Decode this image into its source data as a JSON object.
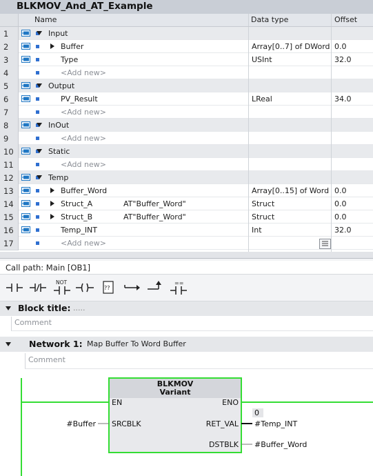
{
  "window": {
    "title": "BLKMOV_And_AT_Example"
  },
  "table": {
    "headers": {
      "name": "Name",
      "datatype": "Data type",
      "offset": "Offset"
    },
    "rows": [
      {
        "num": "1",
        "kind": "group",
        "expand": "down",
        "name": "Input",
        "at": "",
        "datatype": "",
        "offset": ""
      },
      {
        "num": "2",
        "kind": "item",
        "expand": "right",
        "name": "Buffer",
        "at": "",
        "datatype": "Array[0..7] of DWord",
        "offset": "0.0"
      },
      {
        "num": "3",
        "kind": "item",
        "expand": "",
        "name": "Type",
        "at": "",
        "datatype": "USInt",
        "offset": "32.0"
      },
      {
        "num": "4",
        "kind": "add",
        "expand": "",
        "name": "<Add new>",
        "at": "",
        "datatype": "",
        "offset": ""
      },
      {
        "num": "5",
        "kind": "group",
        "expand": "down",
        "name": "Output",
        "at": "",
        "datatype": "",
        "offset": ""
      },
      {
        "num": "6",
        "kind": "item",
        "expand": "",
        "name": "PV_Result",
        "at": "",
        "datatype": "LReal",
        "offset": "34.0"
      },
      {
        "num": "7",
        "kind": "add",
        "expand": "",
        "name": "<Add new>",
        "at": "",
        "datatype": "",
        "offset": ""
      },
      {
        "num": "8",
        "kind": "group",
        "expand": "down",
        "name": "InOut",
        "at": "",
        "datatype": "",
        "offset": ""
      },
      {
        "num": "9",
        "kind": "add",
        "expand": "",
        "name": "<Add new>",
        "at": "",
        "datatype": "",
        "offset": ""
      },
      {
        "num": "10",
        "kind": "group",
        "expand": "down",
        "name": "Static",
        "at": "",
        "datatype": "",
        "offset": ""
      },
      {
        "num": "11",
        "kind": "add",
        "expand": "",
        "name": "<Add new>",
        "at": "",
        "datatype": "",
        "offset": ""
      },
      {
        "num": "12",
        "kind": "group",
        "expand": "down",
        "name": "Temp",
        "at": "",
        "datatype": "",
        "offset": ""
      },
      {
        "num": "13",
        "kind": "item",
        "expand": "right",
        "name": "Buffer_Word",
        "at": "",
        "datatype": "Array[0..15] of Word",
        "offset": "0.0"
      },
      {
        "num": "14",
        "kind": "item",
        "expand": "right",
        "name": "Struct_A",
        "at": "AT\"Buffer_Word\"",
        "datatype": "Struct",
        "offset": "0.0"
      },
      {
        "num": "15",
        "kind": "item",
        "expand": "right",
        "name": "Struct_B",
        "at": "AT\"Buffer_Word\"",
        "datatype": "Struct",
        "offset": "0.0"
      },
      {
        "num": "16",
        "kind": "item",
        "expand": "",
        "name": "Temp_INT",
        "at": "",
        "datatype": "Int",
        "offset": "32.0"
      },
      {
        "num": "17",
        "kind": "add",
        "expand": "",
        "name": "<Add new>",
        "at": "",
        "datatype": "",
        "offset": ""
      }
    ]
  },
  "call_path": "Call path: Main [OB1]",
  "toolbar": {
    "buttons": [
      {
        "name": "contact-no-icon"
      },
      {
        "name": "contact-nc-icon"
      },
      {
        "name": "not-contact-icon",
        "label": "NOT"
      },
      {
        "name": "coil-icon"
      },
      {
        "name": "empty-box-icon",
        "label": "??"
      },
      {
        "name": "open-branch-icon"
      },
      {
        "name": "close-branch-icon"
      },
      {
        "name": "compare-contact-icon",
        "label": "=="
      }
    ]
  },
  "block": {
    "title_label": "Block title:",
    "title_value": ".....",
    "comment_placeholder": "Comment"
  },
  "network": {
    "label": "Network 1:",
    "title": "Map Buffer To Word Buffer",
    "comment_placeholder": "Comment",
    "box": {
      "name": "BLKMOV",
      "type": "Variant",
      "en": "EN",
      "eno": "ENO",
      "in_pin": "SRCBLK",
      "in_value": "#Buffer",
      "out_pin1": "RET_VAL",
      "out_value1": "#Temp_INT",
      "out_current1": "0",
      "out_pin2": "DSTBLK",
      "out_value2": "#Buffer_Word"
    }
  },
  "colors": {
    "wire": "#33dd33",
    "box_border": "#33dd33",
    "interface_icon": "#1f77c4",
    "marker": "#2f6fd0"
  }
}
